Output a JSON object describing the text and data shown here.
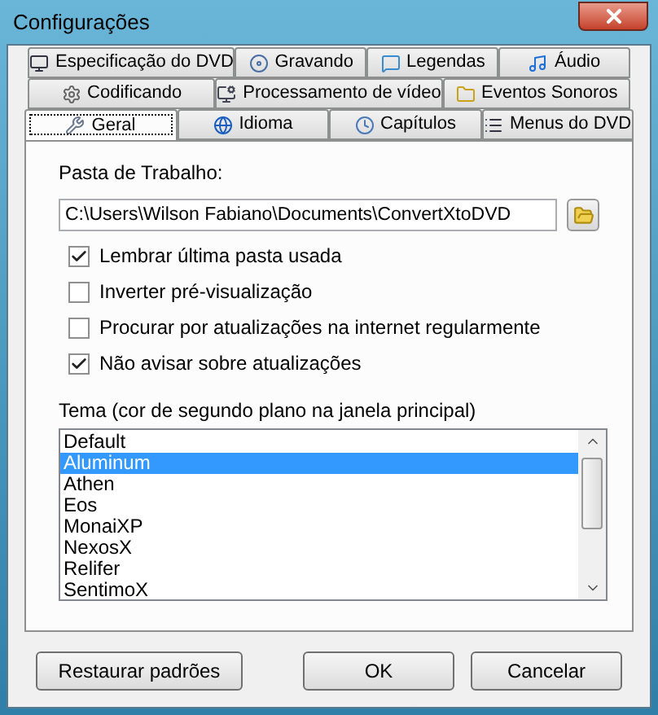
{
  "window": {
    "title": "Configurações"
  },
  "tab_rows": [
    [
      {
        "label": "Especificação do DVD",
        "selected": false
      },
      {
        "label": "Gravando",
        "selected": false
      },
      {
        "label": "Legendas",
        "selected": false
      },
      {
        "label": "Áudio",
        "selected": false
      }
    ],
    [
      {
        "label": "Codificando",
        "selected": false
      },
      {
        "label": "Processamento de vídeo",
        "selected": false
      },
      {
        "label": "Eventos Sonoros",
        "selected": false
      }
    ],
    [
      {
        "label": "Geral",
        "selected": true
      },
      {
        "label": "Idioma",
        "selected": false
      },
      {
        "label": "Capítulos",
        "selected": false
      },
      {
        "label": "Menus do DVD",
        "selected": false
      }
    ]
  ],
  "work_folder": {
    "label": "Pasta de Trabalho:",
    "value": "C:\\Users\\Wilson Fabiano\\Documents\\ConvertXtoDVD"
  },
  "options": [
    {
      "label": "Lembrar última pasta usada",
      "checked": true
    },
    {
      "label": "Inverter pré-visualização",
      "checked": false
    },
    {
      "label": "Procurar por atualizações na internet regularmente",
      "checked": false
    },
    {
      "label": "Não avisar sobre atualizações",
      "checked": true
    }
  ],
  "theme": {
    "label": "Tema (cor de segundo plano na janela principal)",
    "items": [
      {
        "label": "Default",
        "selected": false
      },
      {
        "label": "Aluminum",
        "selected": true
      },
      {
        "label": "Athen",
        "selected": false
      },
      {
        "label": "Eos",
        "selected": false
      },
      {
        "label": "MonaiXP",
        "selected": false
      },
      {
        "label": "NexosX",
        "selected": false
      },
      {
        "label": "Relifer",
        "selected": false
      },
      {
        "label": "SentimoX",
        "selected": false
      }
    ]
  },
  "buttons": [
    "Restaurar padrões",
    "OK",
    "Cancelar"
  ]
}
